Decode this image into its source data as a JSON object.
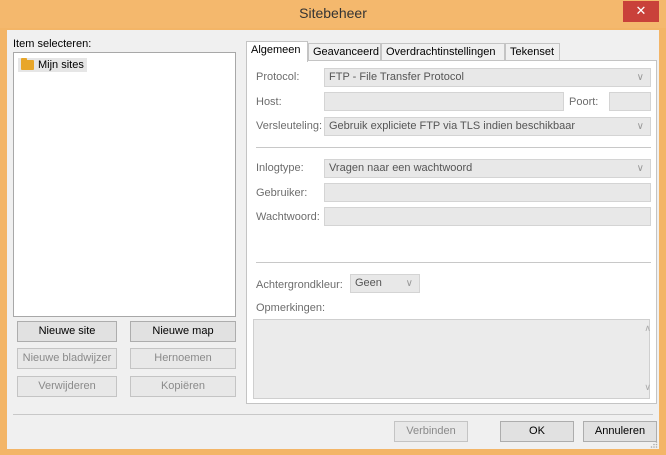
{
  "window": {
    "title": "Sitebeheer",
    "close_glyph": "✕"
  },
  "tree": {
    "label": "Item selecteren:",
    "items": [
      {
        "label": "Mijn sites",
        "icon": "folder-icon"
      }
    ]
  },
  "left_buttons": {
    "new_site": "Nieuwe site",
    "new_folder": "Nieuwe map",
    "new_bookmark": "Nieuwe bladwijzer",
    "rename": "Hernoemen",
    "delete": "Verwijderen",
    "copy": "Kopiëren"
  },
  "tabs": [
    "Algemeen",
    "Geavanceerd",
    "Overdrachtinstellingen",
    "Tekenset"
  ],
  "general": {
    "protocol_label": "Protocol:",
    "protocol_value": "FTP - File Transfer Protocol",
    "host_label": "Host:",
    "host_value": "",
    "port_label": "Poort:",
    "port_value": "",
    "encryption_label": "Versleuteling:",
    "encryption_value": "Gebruik expliciete FTP via TLS indien beschikbaar",
    "logontype_label": "Inlogtype:",
    "logontype_value": "Vragen naar een wachtwoord",
    "user_label": "Gebruiker:",
    "user_value": "",
    "password_label": "Wachtwoord:",
    "password_value": "",
    "bgcolor_label": "Achtergrondkleur:",
    "bgcolor_value": "Geen",
    "comments_label": "Opmerkingen:",
    "comments_value": ""
  },
  "dialog_buttons": {
    "connect": "Verbinden",
    "ok": "OK",
    "cancel": "Annuleren"
  },
  "colors": {
    "titlebar": "#f4b86d",
    "close": "#c9413a",
    "folder": "#e8a629"
  }
}
